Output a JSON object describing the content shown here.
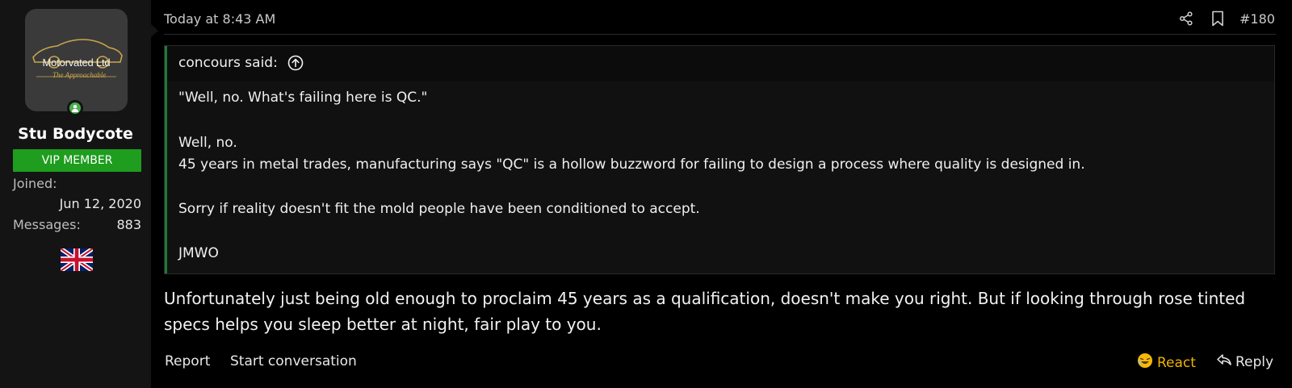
{
  "user": {
    "avatar_logo": "Motorvated Ltd",
    "avatar_tagline": "The Approachable",
    "name": "Stu Bodycote",
    "badge": "VIP MEMBER",
    "joined_label": "Joined:",
    "joined_value": "Jun 12, 2020",
    "messages_label": "Messages:",
    "messages_value": "883",
    "flag": "uk-flag-icon"
  },
  "post": {
    "timestamp": "Today at 8:43 AM",
    "number": "#180",
    "quote": {
      "author": "concours said:",
      "lines": [
        "\"Well, no. What's failing here is QC.\"",
        "Well, no.",
        "45 years in metal trades, manufacturing says \"QC\" is a hollow buzzword for failing to design a process where quality is designed in.",
        "Sorry if reality doesn't fit the mold people have been conditioned to accept.",
        "JMWO"
      ]
    },
    "message": "Unfortunately just being old enough to proclaim 45 years as a qualification, doesn't make you right. But if looking through rose tinted specs helps you sleep better at night, fair play to you."
  },
  "actions": {
    "report": "Report",
    "start_conversation": "Start conversation",
    "react": "React",
    "reply": "Reply"
  },
  "colors": {
    "badge_bg": "#1e9d1e",
    "online": "#4caf50",
    "react": "#f0b400",
    "quote_bar": "#1f7a37"
  }
}
